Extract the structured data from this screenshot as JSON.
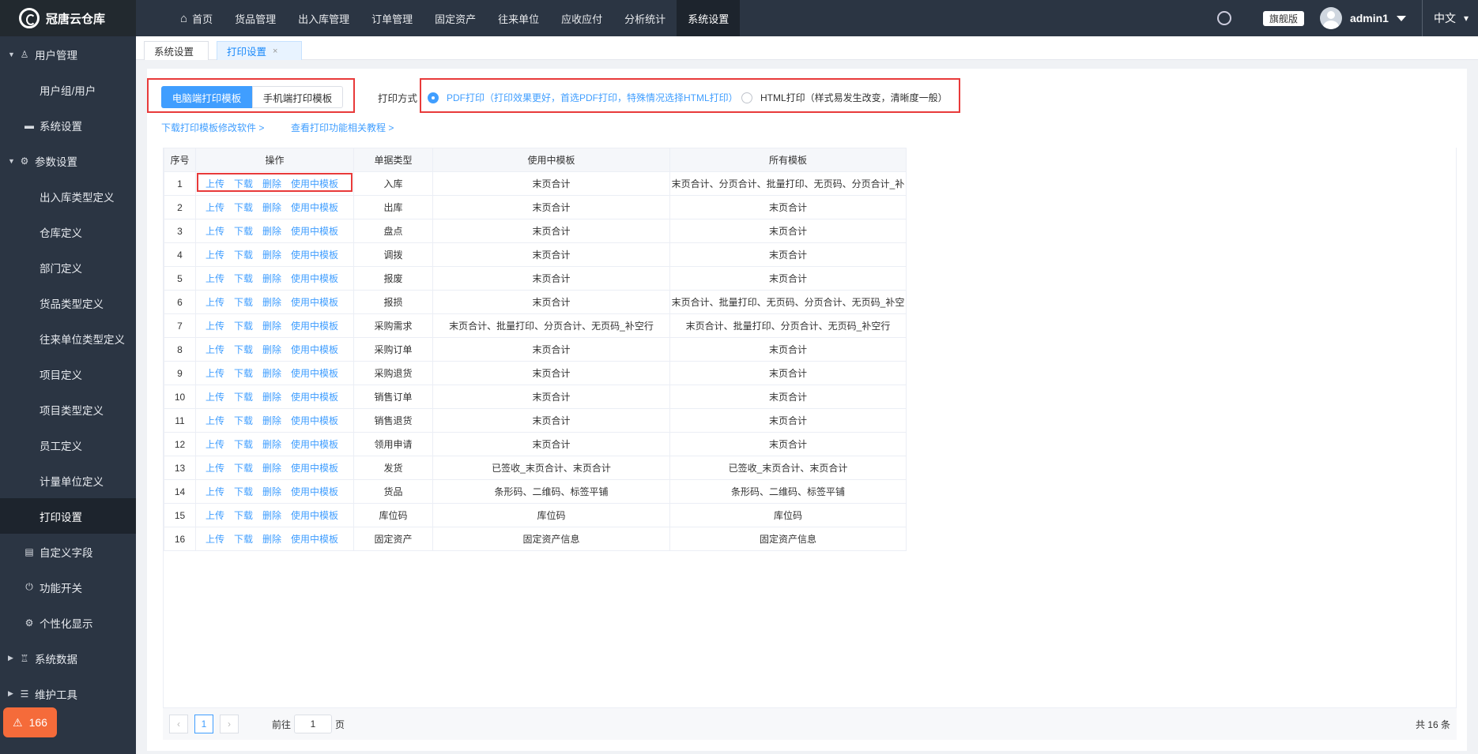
{
  "app": {
    "name": "冠唐云仓库"
  },
  "topnav": {
    "items": [
      "首页",
      "货品管理",
      "出入库管理",
      "订单管理",
      "固定资产",
      "往来单位",
      "应收应付",
      "分析统计",
      "系统设置"
    ]
  },
  "topright": {
    "edition": "旗舰版",
    "user": "admin1",
    "lang": "中文"
  },
  "sidebar": {
    "user_mgmt": "用户管理",
    "user_group": "用户组/用户",
    "sys_settings": "系统设置",
    "param_settings": "参数设置",
    "params": [
      "出入库类型定义",
      "仓库定义",
      "部门定义",
      "货品类型定义",
      "往来单位类型定义",
      "项目定义",
      "项目类型定义",
      "员工定义",
      "计量单位定义",
      "打印设置"
    ],
    "custom_fields": "自定义字段",
    "feature_switch": "功能开关",
    "personalize": "个性化显示",
    "sys_data": "系统数据",
    "maint_tools": "维护工具",
    "alarm_count": "166"
  },
  "tabs": {
    "t1": "系统设置",
    "t2": "打印设置"
  },
  "print": {
    "seg_pc": "电脑端打印模板",
    "seg_mobile": "手机端打印模板",
    "mode_label": "打印方式",
    "pdf_option": "PDF打印（打印效果更好，首选PDF打印，特殊情况选择HTML打印）",
    "html_option": "HTML打印（样式易发生改变，清晰度一般）",
    "link_download": "下载打印模板修改软件 >",
    "link_tutorial": "查看打印功能相关教程 >"
  },
  "table": {
    "headers": [
      "序号",
      "操作",
      "单据类型",
      "使用中模板",
      "所有模板"
    ],
    "ops": [
      "上传",
      "下载",
      "删除",
      "使用中模板"
    ],
    "rows": [
      [
        "1",
        "入库",
        "末页合计",
        "末页合计、分页合计、批量打印、无页码、分页合计_补"
      ],
      [
        "2",
        "出库",
        "末页合计",
        "末页合计"
      ],
      [
        "3",
        "盘点",
        "末页合计",
        "末页合计"
      ],
      [
        "4",
        "调拨",
        "末页合计",
        "末页合计"
      ],
      [
        "5",
        "报废",
        "末页合计",
        "末页合计"
      ],
      [
        "6",
        "报损",
        "末页合计",
        "末页合计、批量打印、无页码、分页合计、无页码_补空"
      ],
      [
        "7",
        "采购需求",
        "末页合计、批量打印、分页合计、无页码_补空行",
        "末页合计、批量打印、分页合计、无页码_补空行"
      ],
      [
        "8",
        "采购订单",
        "末页合计",
        "末页合计"
      ],
      [
        "9",
        "采购退货",
        "末页合计",
        "末页合计"
      ],
      [
        "10",
        "销售订单",
        "末页合计",
        "末页合计"
      ],
      [
        "11",
        "销售退货",
        "末页合计",
        "末页合计"
      ],
      [
        "12",
        "领用申请",
        "末页合计",
        "末页合计"
      ],
      [
        "13",
        "发货",
        "已签收_末页合计、末页合计",
        "已签收_末页合计、末页合计"
      ],
      [
        "14",
        "货品",
        "条形码、二维码、标签平铺",
        "条形码、二维码、标签平铺"
      ],
      [
        "15",
        "库位码",
        "库位码",
        "库位码"
      ],
      [
        "16",
        "固定资产",
        "固定资产信息",
        "固定资产信息"
      ]
    ]
  },
  "pager": {
    "current": "1",
    "goto_prefix": "前往",
    "goto_suffix": "页",
    "input_value": "1",
    "total": "共 16 条"
  }
}
